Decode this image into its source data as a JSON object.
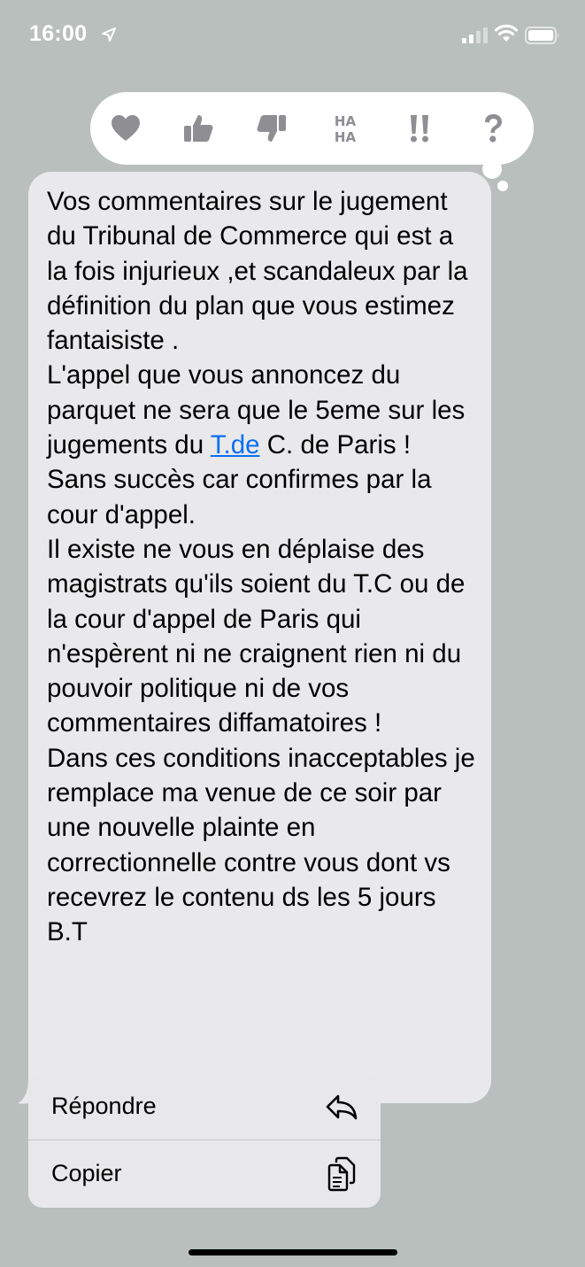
{
  "status_bar": {
    "time": "16:00",
    "icons": [
      "location-arrow-icon",
      "signal-bars-icon",
      "wifi-icon",
      "battery-icon"
    ]
  },
  "tapback": {
    "reactions": [
      "heart-icon",
      "thumbs-up-icon",
      "thumbs-down-icon",
      "haha-icon",
      "exclamation-icon",
      "question-icon"
    ]
  },
  "message": {
    "text_before_link": "Vos commentaires sur le jugement du Tribunal de Commerce qui est a la fois injurieux ,et scandaleux par la définition du plan que vous estimez fantaisiste .\nL'appel que vous annoncez du parquet ne sera que le 5eme sur les jugements du ",
    "link_text": "T.de",
    "text_after_link": " C. de Paris !\nSans succès car confirmes par la cour d'appel.\nIl existe ne vous en déplaise des magistrats qu'ils soient du T.C ou de la cour d'appel de Paris qui n'espèrent ni ne craignent rien ni du pouvoir politique ni de vos commentaires diffamatoires !\nDans ces conditions inacceptables je remplace ma venue de ce soir par une nouvelle plainte en correctionnelle contre vous dont vs recevrez le contenu ds les 5 jours B.T"
  },
  "context_menu": {
    "items": [
      {
        "label": "Répondre",
        "icon": "reply-arrow-icon"
      },
      {
        "label": "Copier",
        "icon": "copy-icon"
      }
    ]
  },
  "colors": {
    "background": "#b8bfbd",
    "bubble": "#e9e9eb",
    "link": "#0b6ff2",
    "tapback_icon": "#8e8e93",
    "menu": "#e8e8ea"
  }
}
